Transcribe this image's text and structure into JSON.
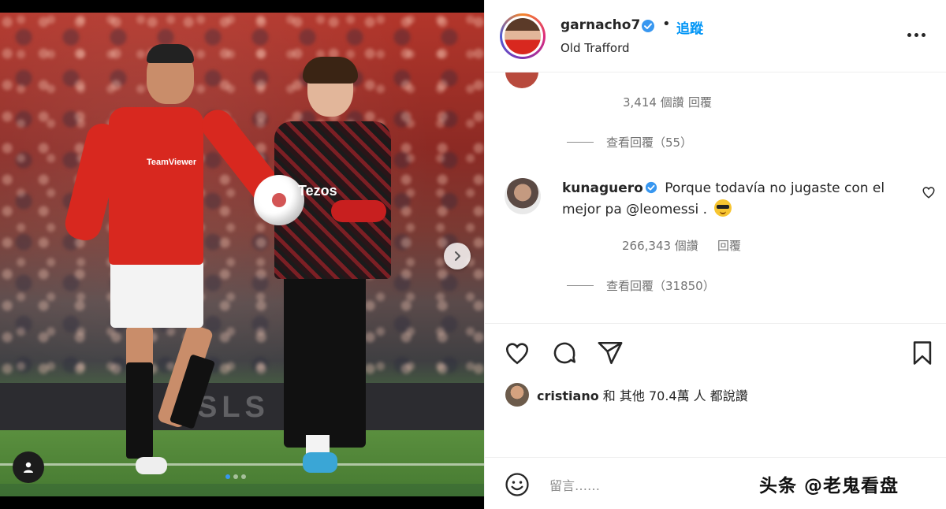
{
  "post": {
    "username": "garnacho7",
    "follow_label": "追蹤",
    "separator": "•",
    "location": "Old Trafford",
    "photo": {
      "sponsor_text": "Tezos",
      "chest_text": "TeamViewer",
      "banner_text": "SLS",
      "carousel_count": 3,
      "carousel_active_index": 0
    }
  },
  "comments": {
    "first": {
      "likes": "3,414 個讚",
      "reply_label": "回覆",
      "view_replies": "查看回覆（55）"
    },
    "second": {
      "username": "kunaguero",
      "text": " Porque todavía no jugaste con el mejor pa @leomessi . ",
      "likes": "266,343 個讚",
      "reply_label": "回覆",
      "view_replies": "查看回覆（31850）"
    }
  },
  "liked_by": {
    "user": "cristiano",
    "rest": " 和 其他 70.4萬 人 都說讚"
  },
  "comment_box": {
    "placeholder": "留言……"
  },
  "watermark": "头条 @老鬼看盘",
  "icons": {
    "verified": "verified-badge-icon",
    "more": "more-options-icon",
    "heart": "heart-icon",
    "comment": "comment-icon",
    "share": "share-icon",
    "save": "bookmark-icon",
    "emoji": "emoji-icon",
    "next": "chevron-right-icon",
    "user_tag": "user-tag-icon"
  },
  "colors": {
    "accent_blue": "#0095f6",
    "muted_text": "#737373",
    "verified_blue": "#3897f0"
  }
}
